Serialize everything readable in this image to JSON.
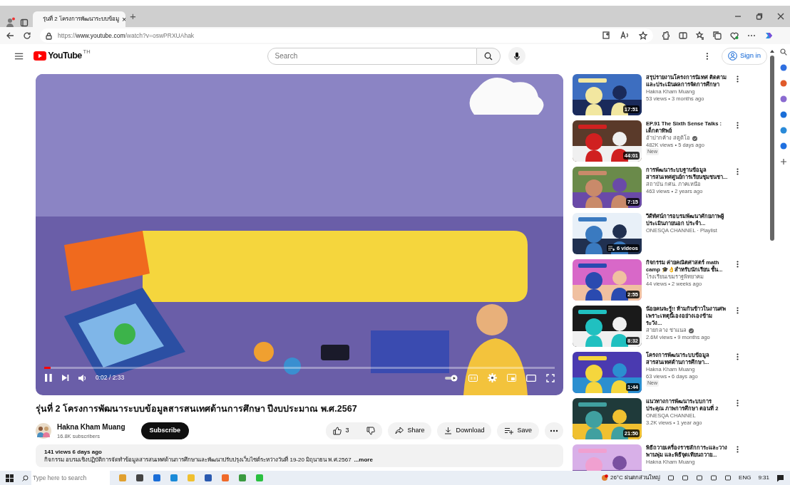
{
  "browser": {
    "tab": {
      "title": "รุ่นที่ 2 โครงการพัฒนาระบบข้อมู",
      "selected": true,
      "close": "×"
    },
    "new_tab": "+",
    "url": {
      "scheme": "https://",
      "host": "www.youtube.com",
      "path": "/watch?v=oswPRXUAhak"
    }
  },
  "header": {
    "logo": "YouTube",
    "region": "TH",
    "search": {
      "placeholder": "Search"
    },
    "sign_in": "Sign in"
  },
  "player": {
    "playing": true,
    "level": 0.013,
    "time": "0:02 / 2:33",
    "autoplay": true
  },
  "video": {
    "title": "รุ่นที่ 2 โครงการพัฒนาระบบข้อมูลสารสนเทศด้านการศึกษา ปีงบประมาณ พ.ศ.2567",
    "channel": "Hakna Kham Muang",
    "subscribers": "16.8K subscribers",
    "subscribe": "Subscribe",
    "likes": "3",
    "share": "Share",
    "download": "Download",
    "save": "Save",
    "stats": "141 views  6 days ago",
    "description": "กิจกรรม อบรมเชิงปฏิบัติการจัดทำข้อมูลสารสนเทศด้านการศึกษาและพัฒนาปรับปรุงเว็บไซต์ระหว่างวันที่ 19-20 มิถุนายน พ.ศ.2567",
    "more": "...more"
  },
  "related": [
    {
      "kind": "video",
      "title": "สรุปรายงานโครงการนิเทศ ติดตาม และประเมินผลการจัดการศึกษา",
      "channel": "Hakna Kham Muang",
      "verified": false,
      "meta": "53 views  • 3 months ago",
      "duration": "17:51"
    },
    {
      "kind": "video",
      "title": "EP.91 The Sixth Sense Talks : เด็กตาทิพย์",
      "channel": "อ้าปากค้าง สตูดิโอ",
      "verified": true,
      "meta": "482K views  • 5 days ago",
      "duration": "44:01",
      "badge": "New"
    },
    {
      "kind": "video",
      "title": "การพัฒนาระบบฐานข้อมูล สารสนเทศศูนย์การเรียนชุมชนชา...",
      "channel": "สถาบัน กศน. ภาคเหนือ",
      "verified": false,
      "meta": "463 views  • 2 years ago",
      "duration": "7:15"
    },
    {
      "kind": "playlist",
      "title": "วีดีทัศน์การอบรมพัฒนาศักยภาพผู้ ประเมินภายนอก ประจำ...",
      "channel": "ONESQA CHANNEL · Playlist",
      "videos": "6 videos"
    },
    {
      "kind": "video",
      "title": "กิจกรรม ค่ายคณิตศาสตร์ math camp 🎓👌สำหรับนักเรียน ชั้น...",
      "channel": "โรงเรียนเขมราฐพิทยาคม",
      "verified": false,
      "meta": "44 views  • 2 weeks ago",
      "duration": "2:55"
    },
    {
      "kind": "video",
      "title": "น้อยคนจะรู้!! ห้ามกินข้าวในงานศพ เพราะเหตุนี้เองอย่างเองข้าม ระวัง...",
      "channel": "สายกลาง ชาแนล",
      "verified": true,
      "meta": "2.6M views  • 9 months ago",
      "duration": "8:32"
    },
    {
      "kind": "video",
      "title": "โครงการพัฒนาระบบข้อมูล สารสนเทศด้านการศึกษา...",
      "channel": "Hakna Kham Muang",
      "verified": false,
      "meta": "63 views  • 6 days ago",
      "duration": "1:44",
      "badge": "New"
    },
    {
      "kind": "video",
      "title": "แนวทางการพัฒนาระบบการประคุณ ภาพการศึกษา ตอนที่ 2",
      "channel": "ONESQA CHANNEL",
      "verified": false,
      "meta": "3.2K views  • 1 year ago",
      "duration": "21:50"
    },
    {
      "kind": "video",
      "title": "พิธีถวายเครื่องราชสักการะและวาง พานพุ่ม และพิธีจุดเทียนถวาย...",
      "channel": "Hakna Kham Muang",
      "verified": false
    }
  ],
  "taskbar": {
    "search": {
      "placeholder": "Type here to search"
    },
    "weather": "26°C ฝนตกส่วนใหญ่",
    "language": "ENG",
    "time": "9:31"
  }
}
